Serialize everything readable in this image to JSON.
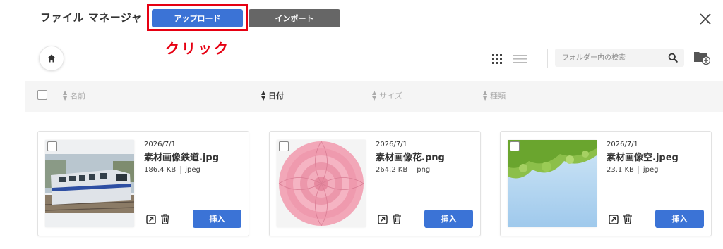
{
  "header": {
    "title": "ファイル マネージャ",
    "upload_label": "アップロード",
    "import_label": "インポート",
    "annotation": "クリック"
  },
  "toolbar": {
    "search_placeholder": "フォルダー内の検索"
  },
  "columns": {
    "name": "名前",
    "date": "日付",
    "size": "サイズ",
    "type": "種類"
  },
  "files": [
    {
      "date": "2026/7/1",
      "name": "素材画像鉄道.jpg",
      "size": "186.4 KB",
      "type": "jpeg",
      "insert_label": "挿入"
    },
    {
      "date": "2026/7/1",
      "name": "素材画像花.png",
      "size": "264.2 KB",
      "type": "png",
      "insert_label": "挿入"
    },
    {
      "date": "2026/7/1",
      "name": "素材画像空.jpeg",
      "size": "23.1 KB",
      "type": "jpeg",
      "insert_label": "挿入"
    }
  ],
  "colors": {
    "primary": "#3b73d6",
    "secondary": "#666666",
    "annotation": "#e60012"
  }
}
